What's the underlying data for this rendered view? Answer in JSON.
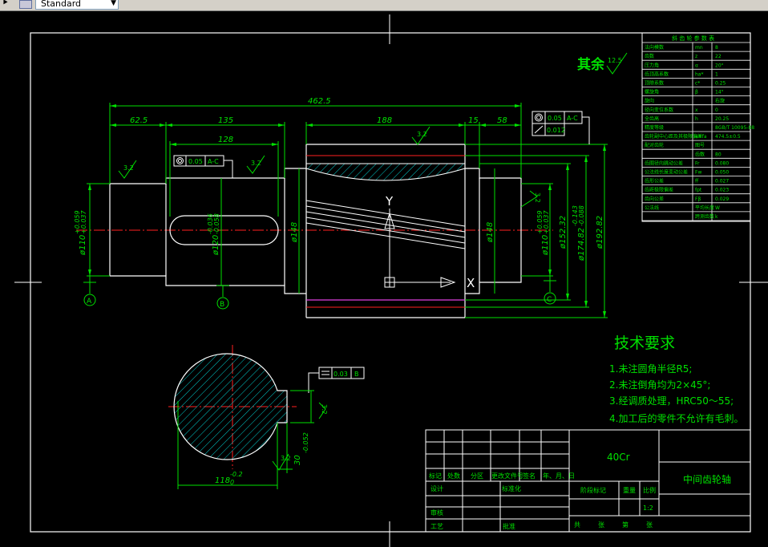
{
  "toolbar": {
    "text_style_combo": "Standard",
    "text_style_arrow": "▼"
  },
  "drawing": {
    "roughness_other_label": "其余",
    "roughness_other_value": "12.5",
    "dims": {
      "overall_length": "462.5",
      "len_62_5": "62.5",
      "len_135": "135",
      "len_128": "128",
      "len_188": "188",
      "len_15": "15",
      "len_58": "58",
      "dia_110_left": "ø110",
      "tol_110_left_upper": "+0.059",
      "tol_110_left_lower": "+0.037",
      "dia_120": "ø120",
      "tol_120_upper": "-0.036",
      "tol_120_lower": "-0.058",
      "dia_148_left": "ø148",
      "dia_148_right": "ø148",
      "dia_110_right": "ø110",
      "tol_110_right_upper": "+0.059",
      "tol_110_right_lower": "+0.037",
      "dia_152": "ø152.32",
      "dia_174": "ø174.82",
      "tol_174_upper": "-0.143",
      "tol_174_lower": "-0.088",
      "dia_192": "ø192.82",
      "section_width": "118",
      "section_tol_upper": "-0.2",
      "section_tol_lower": "0",
      "key_width": "30",
      "key_tol": "-0.052",
      "roughness_a": "3.2",
      "roughness_b": "3.2",
      "roughness_c": "3.2",
      "roughness_d": "3.2",
      "roughness_e": "3.2",
      "roughness_f": "3.2"
    },
    "gdt": {
      "frame1_value": "0.05",
      "frame1_datum": "A-C",
      "frame2_value": "0.05",
      "frame2_datum": "A-C",
      "frame3_value": "0.012",
      "frame4_value": "0.03",
      "frame4_datum": "B"
    },
    "datums": {
      "a": "A",
      "b": "B",
      "c": "C"
    },
    "ucs": {
      "y": "Y",
      "x": "X"
    },
    "tech_req": {
      "title": "技术要求",
      "items": [
        "1.未注圆角半径R5;",
        "2.未注倒角均为2×45°;",
        "3.经调质处理，HRC50～55;",
        "4.加工后的零件不允许有毛刺。"
      ]
    },
    "title_block": {
      "material": "40Cr",
      "part_name": "中间齿轮轴",
      "hdr_labels": [
        "标记",
        "处数",
        "分区",
        "更改文件号",
        "签名",
        "年、月、日"
      ],
      "row_design": "设计",
      "row_standard": "标准化",
      "row_stage_mark": "阶段标记",
      "row_weight": "重量",
      "row_scale": "比例",
      "scale_value": "1:2",
      "row_check": "审核",
      "row_process": "工艺",
      "row_approve": "批准",
      "sheet_total": "共",
      "sheet_unit1": "张",
      "sheet_no": "第",
      "sheet_unit2": "张"
    },
    "param_table": {
      "title": "斜 齿 轮 参 数 表",
      "rows": [
        [
          "法向模数",
          "mn",
          "8"
        ],
        [
          "齿数",
          "z",
          "22"
        ],
        [
          "压力角",
          "α",
          "20°"
        ],
        [
          "齿顶高系数",
          "ha*",
          "1"
        ],
        [
          "顶隙系数",
          "c*",
          "0.25"
        ],
        [
          "螺旋角",
          "β",
          "14°"
        ],
        [
          "旋向",
          "",
          "右旋"
        ],
        [
          "径向变位系数",
          "x",
          "0"
        ],
        [
          "全齿高",
          "h",
          "20.25"
        ],
        [
          "精度等级",
          "",
          "8GB/T 10095-88"
        ],
        [
          "齿轮副中心距及其极限偏差",
          "a±fa",
          "474.5±0.5"
        ],
        [
          "配对齿轮",
          "图号",
          ""
        ],
        [
          "",
          "齿数",
          "80"
        ],
        [
          "齿圈径向跳动公差",
          "Fr",
          "0.080"
        ],
        [
          "公法线长度变动公差",
          "Fw",
          "0.050"
        ],
        [
          "齿形公差",
          "ff",
          "0.027"
        ],
        [
          "齿距极限偏差",
          "fpt",
          "0.023"
        ],
        [
          "齿向公差",
          "Fβ",
          "0.029"
        ],
        [
          "公法线",
          "平均长度",
          "W"
        ],
        [
          "",
          "跨测齿数",
          "k"
        ]
      ]
    }
  }
}
